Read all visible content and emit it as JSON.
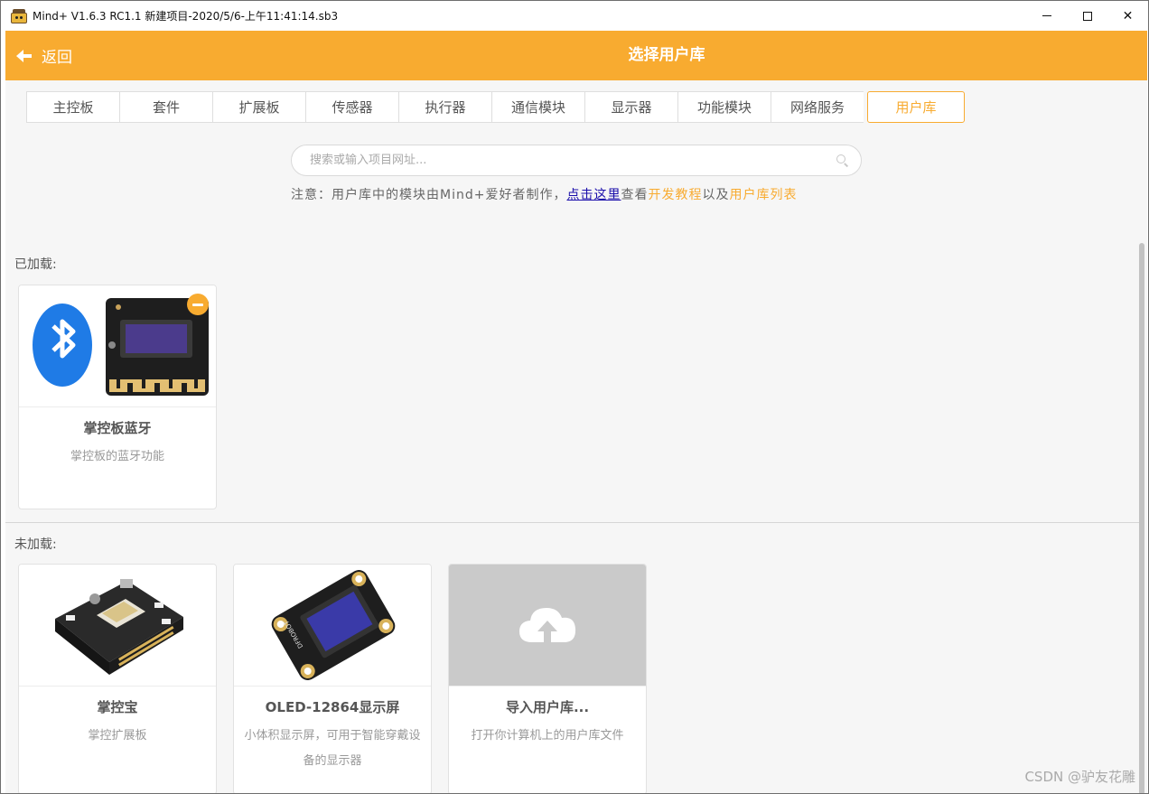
{
  "window": {
    "title": "Mind+ V1.6.3 RC1.1    新建项目-2020/5/6-上午11:41:14.sb3",
    "min_glyph": "—",
    "close_glyph": "✕"
  },
  "header": {
    "back_label": "返回",
    "title": "选择用户库",
    "color": "#f8ab30"
  },
  "tabs": [
    {
      "label": "主控板",
      "active": false
    },
    {
      "label": "套件",
      "active": false
    },
    {
      "label": "扩展板",
      "active": false
    },
    {
      "label": "传感器",
      "active": false
    },
    {
      "label": "执行器",
      "active": false
    },
    {
      "label": "通信模块",
      "active": false
    },
    {
      "label": "显示器",
      "active": false
    },
    {
      "label": "功能模块",
      "active": false
    },
    {
      "label": "网络服务",
      "active": false
    },
    {
      "label": "用户库",
      "active": true
    }
  ],
  "search": {
    "placeholder": "搜索或输入项目网址...",
    "value": ""
  },
  "notice": {
    "prefix": "注意：用户库中的模块由Mind+爱好者制作，",
    "link": "点击这里",
    "middle": "查看",
    "tutorial": "开发教程",
    "and": "以及",
    "list": "用户库列表"
  },
  "loaded": {
    "label": "已加载:",
    "items": [
      {
        "title": "掌控板蓝牙",
        "desc": "掌控板的蓝牙功能"
      }
    ]
  },
  "unloaded": {
    "label": "未加载:",
    "items": [
      {
        "title": "掌控宝",
        "desc": "掌控扩展板"
      },
      {
        "title": "OLED-12864显示屏",
        "desc": "小体积显示屏，可用于智能穿戴设备的显示器"
      },
      {
        "title": "导入用户库...",
        "desc": "打开你计算机上的用户库文件"
      }
    ]
  },
  "oled_logo": "DFROBOT",
  "watermark": "CSDN @驴友花雕"
}
